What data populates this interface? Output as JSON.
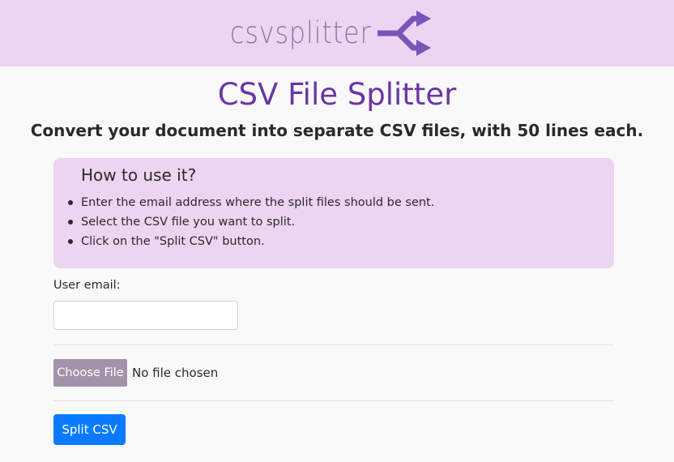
{
  "header": {
    "logo_text": "csvsplitter",
    "logo_icon": "split-arrow-icon",
    "brand_color": "#ecd5f1",
    "logo_color": "#8d74a8"
  },
  "main": {
    "title": "CSV File Splitter",
    "subtitle": "Convert your document into separate CSV files, with 50 lines each.",
    "title_color": "#6a36a6"
  },
  "howto": {
    "title": "How to use it?",
    "steps": [
      "Enter the email address where the split files should be sent.",
      "Select the CSV file you want to split.",
      "Click on the \"Split CSV\" button."
    ]
  },
  "form": {
    "email_label": "User email:",
    "email_value": "",
    "choose_file_label": "Choose File",
    "file_status": "No file chosen",
    "submit_label": "Split CSV",
    "submit_color": "#0a7bff"
  }
}
